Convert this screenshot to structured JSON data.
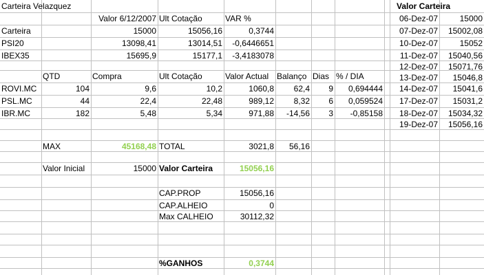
{
  "sheet": {
    "title": "Carteira Velazquez",
    "header1": {
      "valor_label": "Valor 6/12/2007",
      "ult_cotacao": "Ult Cotação",
      "var": "VAR %"
    },
    "indices": [
      {
        "name": "Carteira",
        "valor": "15000",
        "ult": "15056,16",
        "var": "0,3744"
      },
      {
        "name": "PSI20",
        "valor": "13098,41",
        "ult": "13014,51",
        "var": "-0,6446651"
      },
      {
        "name": "IBEX35",
        "valor": "15695,9",
        "ult": "15177,1",
        "var": "-3,4183078"
      }
    ],
    "header2": {
      "qtd": "QTD",
      "compra": "Compra",
      "ult_cotacao": "Ult Cotação",
      "valor_actual": "Valor Actual",
      "balanco": "Balanço",
      "dias": "Dias",
      "pct_dia": "% / DIA"
    },
    "stocks": [
      {
        "name": "ROVI.MC",
        "qtd": "104",
        "compra": "9,6",
        "ult": "10,2",
        "valor": "1060,8",
        "balanco": "62,4",
        "dias": "9",
        "pct": "0,694444"
      },
      {
        "name": "PSL.MC",
        "qtd": "44",
        "compra": "22,4",
        "ult": "22,48",
        "valor": "989,12",
        "balanco": "8,32",
        "dias": "6",
        "pct": "0,059524"
      },
      {
        "name": "IBR.MC",
        "qtd": "182",
        "compra": "5,48",
        "ult": "5,34",
        "valor": "971,88",
        "balanco": "-14,56",
        "dias": "3",
        "pct": "-0,85158"
      }
    ],
    "summary": {
      "max_label": "MAX",
      "max_value": "45168,48",
      "total_label": "TOTAL",
      "total_value": "3021,8",
      "total_balanco": "56,16",
      "valor_inicial_label": "Valor Inicial",
      "valor_inicial_value": "15000",
      "valor_carteira_label": "Valor Carteira",
      "valor_carteira_value": "15056,16",
      "cap_prop_label": "CAP.PROP",
      "cap_prop_value": "15056,16",
      "cap_alheio_label": "CAP.ALHEIO",
      "cap_alheio_value": "0",
      "max_calheio_label": "Max CALHEIO",
      "max_calheio_value": "30112,32",
      "ganhos_label": "%GANHOS",
      "ganhos_value": "0,3744"
    },
    "history": {
      "title": "Valor Carteira",
      "rows": [
        {
          "date": "06-Dez-07",
          "value": "15000"
        },
        {
          "date": "07-Dez-07",
          "value": "15002,08"
        },
        {
          "date": "10-Dez-07",
          "value": "15052"
        },
        {
          "date": "11-Dez-07",
          "value": "15040,56"
        },
        {
          "date": "12-Dez-07",
          "value": "15071,76"
        },
        {
          "date": "13-Dez-07",
          "value": "15046,8"
        },
        {
          "date": "14-Dez-07",
          "value": "15041,6"
        },
        {
          "date": "17-Dez-07",
          "value": "15031,2"
        },
        {
          "date": "18-Dez-07",
          "value": "15034,32"
        },
        {
          "date": "19-Dez-07",
          "value": "15056,16"
        }
      ]
    },
    "colors": {
      "grid": "#c0c0c0",
      "highlight_green": "#92d050"
    }
  }
}
